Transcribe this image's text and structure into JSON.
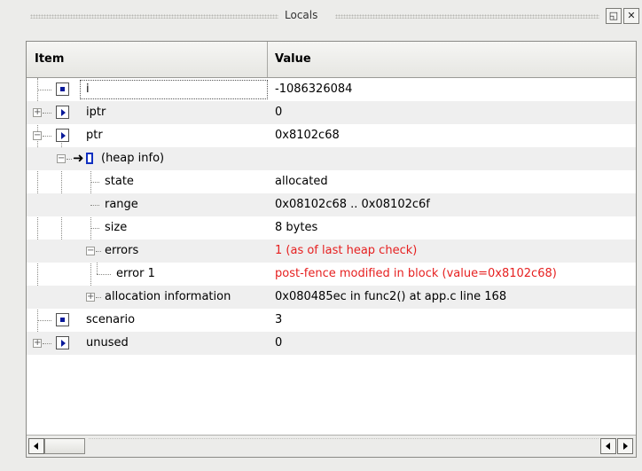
{
  "panel": {
    "title": "Locals",
    "float_icon": "float-window-icon",
    "close_icon": "close-icon"
  },
  "columns": {
    "item": "Item",
    "value": "Value"
  },
  "rows": [
    {
      "name": "i",
      "value": "-1086326084",
      "icon": "variable-icon",
      "expander": "none",
      "depth": 0,
      "error": false
    },
    {
      "name": "iptr",
      "value": "0",
      "icon": "pointer-icon",
      "expander": "collapsed",
      "depth": 0,
      "error": false
    },
    {
      "name": "ptr",
      "value": "0x8102c68",
      "icon": "pointer-icon",
      "expander": "expanded",
      "depth": 0,
      "error": false
    },
    {
      "name": "(heap info)",
      "value": "",
      "icon": "heap-info-icon",
      "expander": "expanded",
      "depth": 1,
      "error": false
    },
    {
      "name": "state",
      "value": "allocated",
      "icon": "",
      "expander": "none",
      "depth": 2,
      "error": false
    },
    {
      "name": "range",
      "value": "0x08102c68 .. 0x08102c6f",
      "icon": "",
      "expander": "none",
      "depth": 2,
      "error": false
    },
    {
      "name": "size",
      "value": "8 bytes",
      "icon": "",
      "expander": "none",
      "depth": 2,
      "error": false
    },
    {
      "name": "errors",
      "value": "1 (as of last heap check)",
      "icon": "",
      "expander": "expanded",
      "depth": 2,
      "error": true
    },
    {
      "name": "error 1",
      "value": "post-fence modified in block (value=0x8102c68)",
      "icon": "",
      "expander": "none",
      "depth": 3,
      "error": true
    },
    {
      "name": "allocation information",
      "value": "0x080485ec in func2() at app.c line 168",
      "icon": "",
      "expander": "collapsed",
      "depth": 2,
      "error": false
    },
    {
      "name": "scenario",
      "value": "3",
      "icon": "variable-icon",
      "expander": "none",
      "depth": 0,
      "error": false
    },
    {
      "name": "unused",
      "value": "0",
      "icon": "pointer-icon",
      "expander": "collapsed",
      "depth": 0,
      "error": false
    }
  ],
  "colors": {
    "error_text": "#e62020",
    "icon_blue": "#0a1a9a",
    "alt_row": "#efefef"
  }
}
